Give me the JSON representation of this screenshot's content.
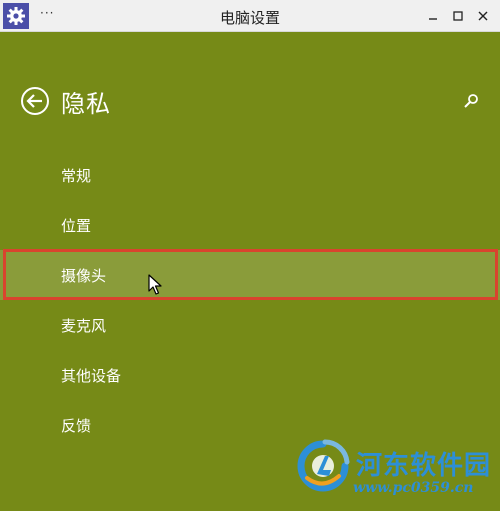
{
  "window": {
    "title": "电脑设置",
    "menu_dots": "···",
    "colors": {
      "background": "#768a17",
      "titlebar": "#f0f0f0",
      "selected_item": "#8a9c3a",
      "highlight_border": "#d9442e",
      "text": "#ffffff"
    }
  },
  "header": {
    "back_icon": "back-arrow-icon",
    "title": "隐私",
    "search_icon": "search-icon"
  },
  "nav": {
    "items": [
      {
        "label": "常规"
      },
      {
        "label": "位置"
      },
      {
        "label": "摄像头",
        "selected": true
      },
      {
        "label": "麦克风"
      },
      {
        "label": "其他设备"
      },
      {
        "label": "反馈"
      }
    ]
  },
  "watermark": {
    "name": "河东软件园",
    "url": "www.pc0359.cn"
  }
}
